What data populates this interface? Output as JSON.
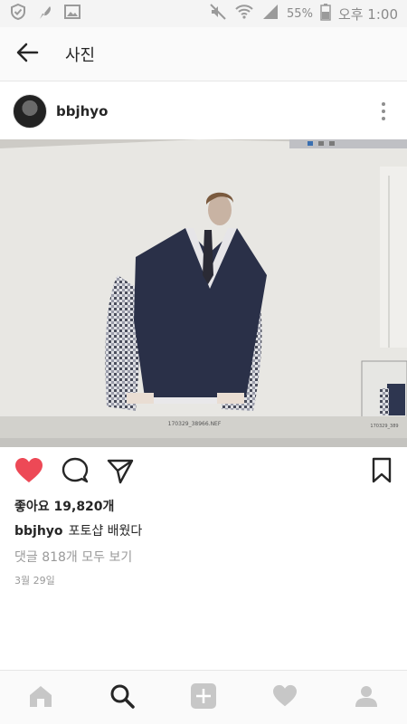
{
  "status_bar": {
    "battery": "55%",
    "time": "오후 1:00"
  },
  "app_bar": {
    "title": "사진"
  },
  "post": {
    "username": "bbjhyo",
    "image_filename": "170329_38966.NEF",
    "image_filename_small": "170329_389",
    "likes": "좋아요 19,820개",
    "caption_user": "bbjhyo",
    "caption_text": "포토샵 배웠다",
    "comments_link": "댓글 818개 모두 보기",
    "date": "3월 29일"
  },
  "colors": {
    "like_red": "#ed4956",
    "icon_dark": "#262626",
    "nav_gray": "#c7c7c7"
  },
  "icons": [
    "shield-icon",
    "feather-icon",
    "image-icon",
    "mute-icon",
    "wifi-icon",
    "signal-icon",
    "battery-icon",
    "back-arrow-icon",
    "more-icon",
    "heart-icon",
    "comment-icon",
    "share-icon",
    "bookmark-icon",
    "home-icon",
    "search-icon",
    "add-icon",
    "activity-heart-icon",
    "profile-icon"
  ]
}
